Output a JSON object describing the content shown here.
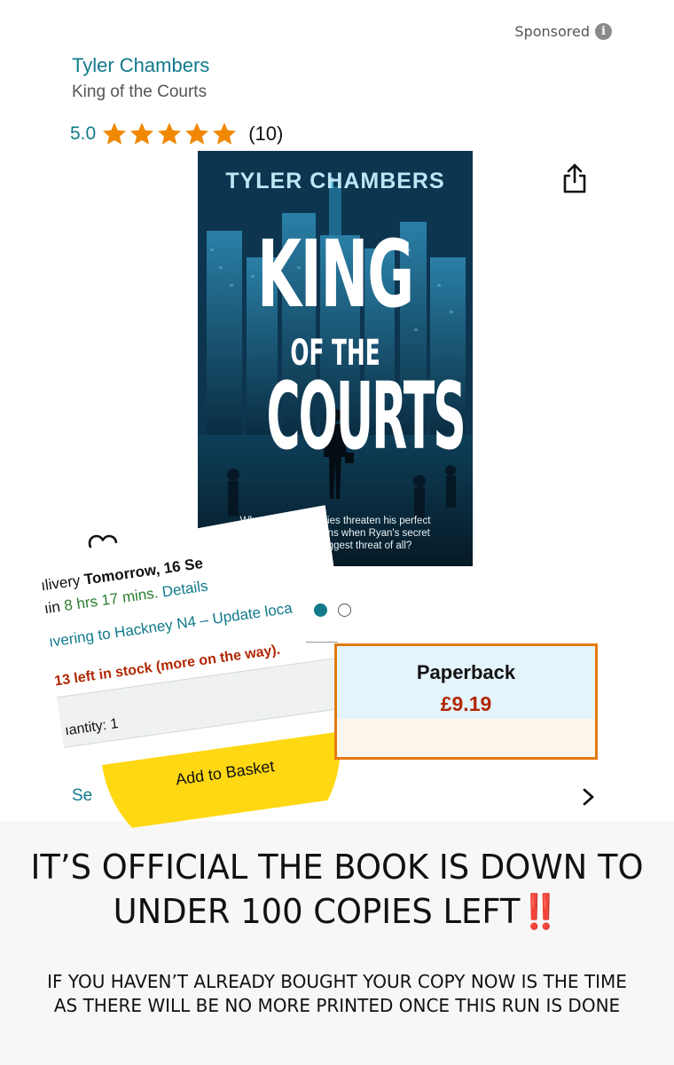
{
  "sponsored": {
    "label": "Sponsored",
    "icon": "info-icon"
  },
  "product": {
    "author": "Tyler Chambers",
    "title": "King of the Courts",
    "rating_value": "5.0",
    "rating_stars": 5,
    "rating_count": "(10)"
  },
  "cover": {
    "author": "TYLER CHAMBERS",
    "title_line1": "KING",
    "title_line2": "OF THE",
    "title_line3": "COURTS",
    "blurb": "When secrets and lies threaten his perfect record, what happens when Ryan's secret becomes the biggest threat of all?"
  },
  "overlay": {
    "delivery_prefix": "ılivery ",
    "delivery_date": "Tomorrow, 16 Se",
    "timer_prefix": "ıin ",
    "timer_value": "8 hrs 17 mins.",
    "details_link": " Details",
    "location": "ıvering to Hackney N4 – Update loca",
    "stock": "13 left in stock (more on the way).",
    "quantity": "ıantity: 1",
    "add_to_basket": "Add to Basket"
  },
  "carousel": {
    "active_index": 0,
    "count": 2
  },
  "format": {
    "label": "Paperback",
    "price": "£9.19"
  },
  "see_link": "Se",
  "colors": {
    "link": "#117a8b",
    "price": "#b12704",
    "accent": "#e47911",
    "button": "#ffd814",
    "star": "#f08804"
  },
  "announcement": {
    "headline": "IT’S OFFICIAL THE BOOK IS DOWN TO UNDER 100 COPIES LEFT",
    "headline_mark": "‼️",
    "subtext": "IF YOU HAVEN’T ALREADY BOUGHT YOUR COPY NOW IS THE TIME AS THERE WILL BE NO MORE PRINTED ONCE THIS RUN IS DONE"
  }
}
